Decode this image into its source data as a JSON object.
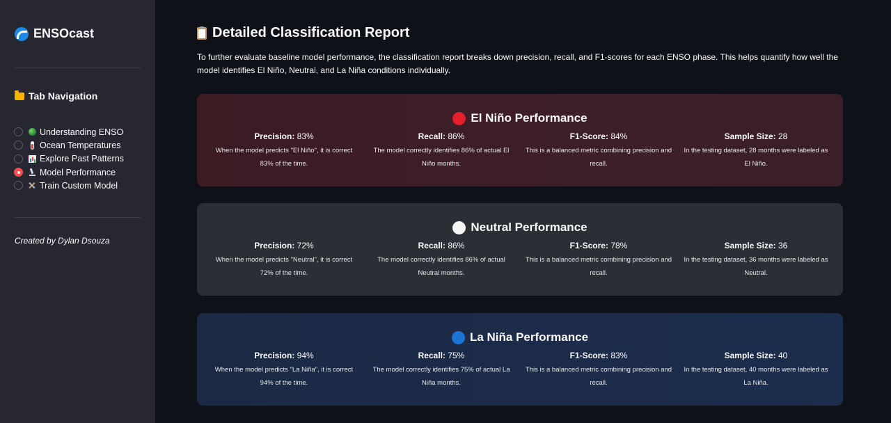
{
  "sidebar": {
    "brand": "ENSOcast",
    "nav_title": "Tab Navigation",
    "items": [
      {
        "label": "Understanding ENSO",
        "selected": false,
        "icon": "globe-icon"
      },
      {
        "label": "Ocean Temperatures",
        "selected": false,
        "icon": "thermometer-icon"
      },
      {
        "label": "Explore Past Patterns",
        "selected": false,
        "icon": "bar-chart-icon"
      },
      {
        "label": "Model Performance",
        "selected": true,
        "icon": "microscope-icon"
      },
      {
        "label": "Train Custom Model",
        "selected": false,
        "icon": "hammer-wrench-icon"
      }
    ],
    "credit": "Created by Dylan Dsouza"
  },
  "main": {
    "title": "Detailed Classification Report",
    "intro": "To further evaluate baseline model performance, the classification report breaks down precision, recall, and F1-scores for each ENSO phase. This helps quantify how well the model identifies El Niño, Neutral, and La Niña conditions individually.",
    "cards": [
      {
        "title": "El Niño Performance",
        "color": "#e41e2b",
        "metrics": [
          {
            "label": "Precision:",
            "value": "83%",
            "desc": "When the model predicts \"El Niño\", it is correct 83% of the time."
          },
          {
            "label": "Recall:",
            "value": "86%",
            "desc": "The model correctly identifies 86% of actual El Niño months."
          },
          {
            "label": "F1-Score:",
            "value": "84%",
            "desc": "This is a balanced metric combining precision and recall."
          },
          {
            "label": "Sample Size:",
            "value": "28",
            "desc": "In the testing dataset, 28 months were labeled as El Niño."
          }
        ]
      },
      {
        "title": "Neutral Performance",
        "color": "#f5f5f5",
        "metrics": [
          {
            "label": "Precision:",
            "value": "72%",
            "desc": "When the model predicts \"Neutral\", it is correct 72% of the time."
          },
          {
            "label": "Recall:",
            "value": "86%",
            "desc": "The model correctly identifies 86% of actual Neutral months."
          },
          {
            "label": "F1-Score:",
            "value": "78%",
            "desc": "This is a balanced metric combining precision and recall."
          },
          {
            "label": "Sample Size:",
            "value": "36",
            "desc": "In the testing dataset, 36 months were labeled as Neutral."
          }
        ]
      },
      {
        "title": "La Niña Performance",
        "color": "#1e74d6",
        "metrics": [
          {
            "label": "Precision:",
            "value": "94%",
            "desc": "When the model predicts \"La Niña\", it is correct 94% of the time."
          },
          {
            "label": "Recall:",
            "value": "75%",
            "desc": "The model correctly identifies 75% of actual La Niña months."
          },
          {
            "label": "F1-Score:",
            "value": "83%",
            "desc": "This is a balanced metric combining precision and recall."
          },
          {
            "label": "Sample Size:",
            "value": "40",
            "desc": "In the testing dataset, 40 months were labeled as La Niña."
          }
        ]
      }
    ]
  }
}
